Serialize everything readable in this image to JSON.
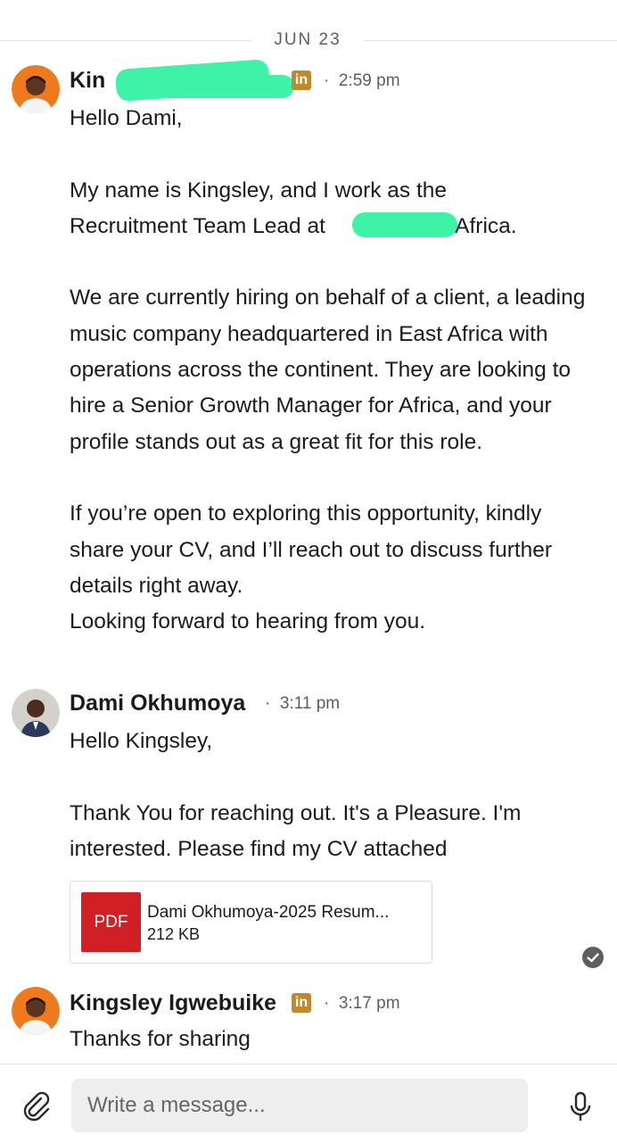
{
  "date_separator": "JUN 23",
  "messages": [
    {
      "sender_visible": "Kin",
      "sender_visible_tail": "in",
      "time": "2:59 pm",
      "line_hello": "Hello Dami,",
      "line_intro_1": "My name is Kingsley, and I work as the",
      "line_intro_2a": "Recruitment Team Lead at",
      "line_intro_2b": "er Africa.",
      "para_2": "We are currently hiring on behalf of a client, a leading music company headquartered in East Africa with operations across the continent. They are looking to hire a Senior Growth Manager for Africa, and your profile stands out as a great fit for this role.",
      "para_3": "If you’re open to exploring this opportunity, kindly share your CV, and I’ll reach out to discuss further details right away.",
      "para_4": "Looking forward to hearing from you."
    },
    {
      "sender": "Dami Okhumoya",
      "time": "3:11 pm",
      "line_hello": "Hello Kingsley,",
      "para_2": "Thank You for reaching out. It's a Pleasure. I'm interested. Please find my CV attached",
      "attachment": {
        "type_label": "PDF",
        "file_name": "Dami Okhumoya-2025 Resum...",
        "file_size": "212 KB"
      }
    },
    {
      "sender": "Kingsley Igwebuike",
      "time": "3:17 pm",
      "text": "Thanks for sharing"
    }
  ],
  "composer": {
    "placeholder": "Write a message..."
  },
  "icons": {
    "linkedin_badge": "linkedin-icon",
    "read_receipt": "check-circle-icon",
    "attach": "paperclip-icon",
    "voice": "microphone-icon"
  },
  "colors": {
    "linkedin_badge": "#c08a2a",
    "redaction": "#3ef2a7",
    "pdf_tile": "#d11f26",
    "composer_bg": "#eeeeee"
  }
}
